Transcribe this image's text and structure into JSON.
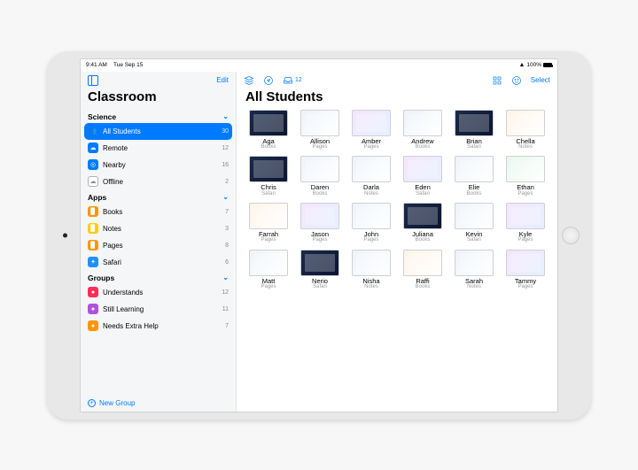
{
  "statusbar": {
    "time": "9:41 AM",
    "date": "Tue Sep 15",
    "battery": "100%"
  },
  "sidebar": {
    "edit": "Edit",
    "title": "Classroom",
    "sections": {
      "science": "Science",
      "apps": "Apps",
      "groups": "Groups"
    },
    "science_items": [
      {
        "label": "All Students",
        "count": "30"
      },
      {
        "label": "Remote",
        "count": "12"
      },
      {
        "label": "Nearby",
        "count": "16"
      },
      {
        "label": "Offline",
        "count": "2"
      }
    ],
    "app_items": [
      {
        "label": "Books",
        "count": "7"
      },
      {
        "label": "Notes",
        "count": "3"
      },
      {
        "label": "Pages",
        "count": "8"
      },
      {
        "label": "Safari",
        "count": "6"
      }
    ],
    "group_items": [
      {
        "label": "Understands",
        "count": "12"
      },
      {
        "label": "Still Learning",
        "count": "11"
      },
      {
        "label": "Needs Extra Help",
        "count": "7"
      }
    ],
    "new_group": "New Group"
  },
  "main": {
    "inbox_count": "12",
    "select": "Select",
    "title": "All Students",
    "students": [
      {
        "name": "Aga",
        "app": "Books",
        "t": "dark"
      },
      {
        "name": "Allison",
        "app": "Pages",
        "t": ""
      },
      {
        "name": "Amber",
        "app": "Pages",
        "t": "mix"
      },
      {
        "name": "Andrew",
        "app": "Books",
        "t": ""
      },
      {
        "name": "Brian",
        "app": "Safari",
        "t": "dark"
      },
      {
        "name": "Chella",
        "app": "Notes",
        "t": "warm"
      },
      {
        "name": "Chris",
        "app": "Safari",
        "t": "dark"
      },
      {
        "name": "Daren",
        "app": "Books",
        "t": ""
      },
      {
        "name": "Darla",
        "app": "Notes",
        "t": ""
      },
      {
        "name": "Eden",
        "app": "Safari",
        "t": "mix"
      },
      {
        "name": "Elie",
        "app": "Books",
        "t": ""
      },
      {
        "name": "Ethan",
        "app": "Pages",
        "t": "green"
      },
      {
        "name": "Farrah",
        "app": "Pages",
        "t": "warm"
      },
      {
        "name": "Jason",
        "app": "Pages",
        "t": "mix"
      },
      {
        "name": "John",
        "app": "Pages",
        "t": ""
      },
      {
        "name": "Juliana",
        "app": "Books",
        "t": "dark"
      },
      {
        "name": "Kevin",
        "app": "Safari",
        "t": ""
      },
      {
        "name": "Kyle",
        "app": "Pages",
        "t": "mix"
      },
      {
        "name": "Matt",
        "app": "Pages",
        "t": ""
      },
      {
        "name": "Nerio",
        "app": "Safari",
        "t": "dark"
      },
      {
        "name": "Nisha",
        "app": "Notes",
        "t": ""
      },
      {
        "name": "Raffi",
        "app": "Books",
        "t": "warm"
      },
      {
        "name": "Sarah",
        "app": "Notes",
        "t": ""
      },
      {
        "name": "Tammy",
        "app": "Pages",
        "t": "mix"
      }
    ]
  }
}
